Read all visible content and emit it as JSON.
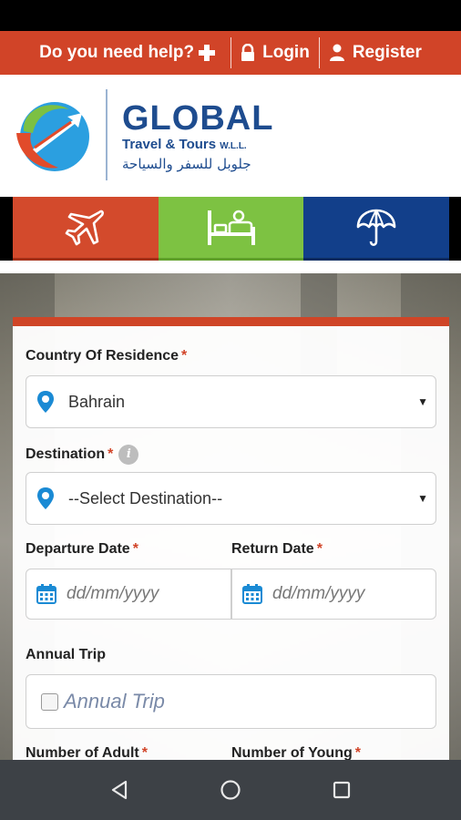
{
  "top_bar": {
    "help_label": "Do you need help?",
    "login_label": "Login",
    "register_label": "Register"
  },
  "brand": {
    "name": "GLOBAL",
    "subtitle": "Travel & Tours",
    "suffix": "W.L.L.",
    "arabic": "جلوبل للسفر والسياحة"
  },
  "tabs": [
    {
      "icon": "airplane-icon",
      "color": "#d34a2c"
    },
    {
      "icon": "hotel-bed-icon",
      "color": "#7dc242"
    },
    {
      "icon": "umbrella-icon",
      "color": "#123f8a"
    }
  ],
  "form": {
    "country_label": "Country Of Residence",
    "country_value": "Bahrain",
    "destination_label": "Destination",
    "destination_value": "--Select Destination--",
    "departure_label": "Departure Date",
    "departure_placeholder": "dd/mm/yyyy",
    "return_label": "Return Date",
    "return_placeholder": "dd/mm/yyyy",
    "annual_label": "Annual Trip",
    "annual_checkbox_label": "Annual Trip",
    "adult_label": "Number of Adult",
    "young_label": "Number of Young",
    "required_mark": "*",
    "info_mark": "i"
  },
  "colors": {
    "accent_red": "#d14428",
    "brand_blue": "#1e4c8f",
    "hotel_green": "#7dc242",
    "pin_blue": "#1a8ad4"
  }
}
